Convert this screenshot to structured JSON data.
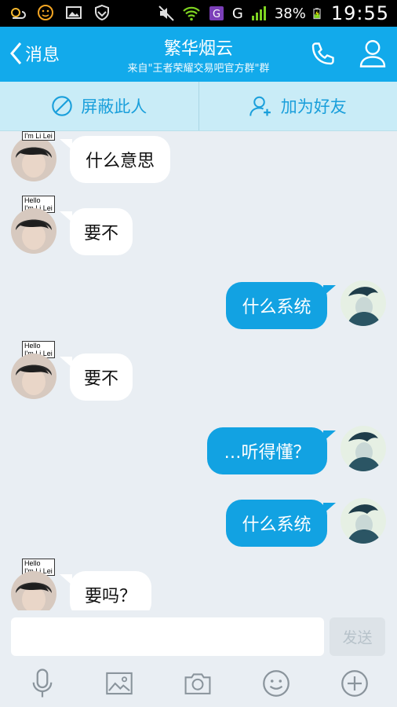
{
  "status_bar": {
    "battery": "38%",
    "clock": "19:55",
    "network": "G",
    "icons": [
      "weather-icon",
      "emoji-notify-icon",
      "gallery-icon",
      "vpn-shield-icon",
      "mute-icon",
      "wifi-icon",
      "app-g-icon",
      "signal-icon",
      "battery-icon"
    ]
  },
  "header": {
    "back_label": "消息",
    "title": "繁华烟云",
    "subtitle": "来自\"王者荣耀交易吧官方群\"群",
    "accent_color": "#12aaeb"
  },
  "actions": {
    "block_label": "屏蔽此人",
    "add_friend_label": "加为好友"
  },
  "messages": [
    {
      "side": "in",
      "text": "什么意思",
      "tag": [
        "I'm Li Lei"
      ]
    },
    {
      "side": "in",
      "text": "要不",
      "tag": [
        "Hello",
        "I'm Li Lei"
      ]
    },
    {
      "side": "out",
      "text": "什么系统"
    },
    {
      "side": "in",
      "text": "要不",
      "tag": [
        "Hello",
        "I'm Li Lei"
      ]
    },
    {
      "side": "out",
      "text": "…听得懂？"
    },
    {
      "side": "out",
      "text": "什么系统"
    },
    {
      "side": "in",
      "text": "要吗？",
      "tag": [
        "Hello",
        "I'm Li Lei"
      ]
    }
  ],
  "input": {
    "value": "",
    "placeholder": "",
    "send_label": "发送"
  },
  "toolbar": [
    "mic-icon",
    "image-icon",
    "camera-icon",
    "emoji-icon",
    "plus-icon"
  ]
}
